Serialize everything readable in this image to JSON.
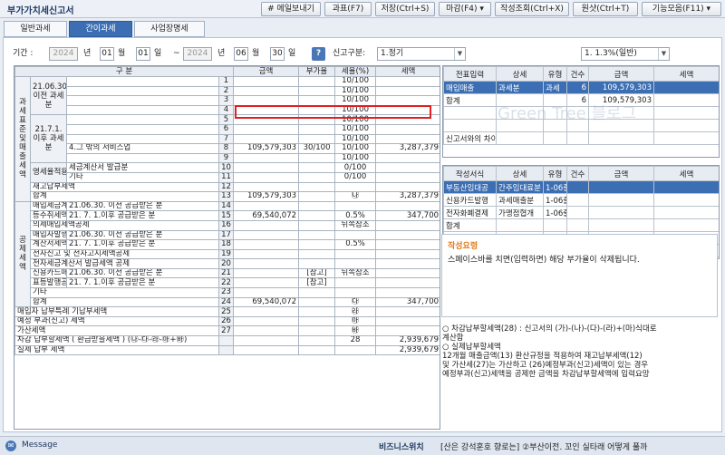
{
  "window": {
    "title": "부가가치세신고서"
  },
  "toolbar": {
    "buttons": [
      "# 메일보내기",
      "과표(F7)",
      "저장(Ctrl+S)",
      "마감(F4) ▾",
      "작성조회(Ctrl+X)",
      "원샷(Ctrl+T)",
      "기능모음(F11) ▾"
    ]
  },
  "tabs": [
    "일반과세",
    "간이과세",
    "사업장명세"
  ],
  "criteria": {
    "period_label": "기간 :",
    "start_year": "2024",
    "start_month": "01",
    "start_day": "01",
    "end_year": "2024",
    "end_month": "06",
    "end_day": "30",
    "year_unit": "년",
    "month_unit": "월",
    "day_unit": "일",
    "tilde": "~",
    "help": "?",
    "report_type_label": "신고구분:",
    "report_type": "1.정기",
    "rate_option": "1. 1.3%(일반)"
  },
  "main_table": {
    "header": [
      "구 분",
      "금액",
      "부가율",
      "세율(%)",
      "세액"
    ],
    "side_labels": {
      "tax_base": "과세표준및매출세액",
      "deduction": "공제세액"
    },
    "rows": [
      {
        "g": "21.06.30.이전 과세분",
        "sub": "",
        "no": "1",
        "amt": "",
        "rate": "",
        "pct": "10/100",
        "tax": ""
      },
      {
        "g": "",
        "sub": "",
        "no": "2",
        "amt": "",
        "rate": "",
        "pct": "10/100",
        "tax": ""
      },
      {
        "g": "",
        "sub": "",
        "no": "3",
        "amt": "",
        "rate": "",
        "pct": "10/100",
        "tax": ""
      },
      {
        "g": "",
        "sub": "",
        "no": "4",
        "amt": "",
        "rate": "",
        "pct": "10/100",
        "tax": ""
      },
      {
        "g": "21.7.1.이후 과세분",
        "sub": "",
        "no": "5",
        "amt": "",
        "rate": "",
        "pct": "10/100",
        "tax": ""
      },
      {
        "g": "",
        "sub": "",
        "no": "6",
        "amt": "",
        "rate": "",
        "pct": "10/100",
        "tax": ""
      },
      {
        "g": "",
        "sub": "",
        "no": "7",
        "amt": "",
        "rate": "",
        "pct": "10/100",
        "tax": ""
      },
      {
        "g": "",
        "sub": "4.그 밖의 서비스업",
        "no": "8",
        "amt": "109,579,303",
        "rate": "30/100",
        "pct": "10/100",
        "tax": "3,287,379"
      },
      {
        "g": "",
        "sub": "",
        "no": "9",
        "amt": "",
        "rate": "",
        "pct": "10/100",
        "tax": ""
      },
      {
        "g": "영세율적용분",
        "sub": "세금계산서 발급분",
        "no": "10",
        "amt": "",
        "rate": "",
        "pct": "0/100",
        "tax": ""
      },
      {
        "g": "",
        "sub": "기타",
        "no": "11",
        "amt": "",
        "rate": "",
        "pct": "0/100",
        "tax": ""
      },
      {
        "g": "재고납부세액",
        "sub": "",
        "no": "12",
        "amt": "",
        "rate": "",
        "pct": "",
        "tax": ""
      },
      {
        "g": "합계",
        "sub": "",
        "no": "13",
        "amt": "109,579,303",
        "rate": "",
        "pct": "㉯",
        "tax": "3,287,379"
      },
      {
        "g": "매입세금계산서",
        "sub": "21.06.30. 이전 공급받은 분",
        "no": "14",
        "amt": "",
        "rate": "",
        "pct": "",
        "tax": ""
      },
      {
        "g": "등수취세액공제",
        "sub": "21. 7. 1.이후 공급받은 분",
        "no": "15",
        "amt": "69,540,072",
        "rate": "",
        "pct": "0.5%",
        "tax": "347,700"
      },
      {
        "g": "의제매입세액공제",
        "sub": "",
        "no": "16",
        "amt": "",
        "rate": "",
        "pct": "뒤쪽참조",
        "tax": ""
      },
      {
        "g": "매입자발행세금",
        "sub": "21.06.30. 이전 공급받은 분",
        "no": "17",
        "amt": "",
        "rate": "",
        "pct": "",
        "tax": ""
      },
      {
        "g": "계산서세액공제",
        "sub": "21. 7. 1.이후 공급받은 분",
        "no": "18",
        "amt": "",
        "rate": "",
        "pct": "0.5%",
        "tax": ""
      },
      {
        "g": "전자신고 및 전자고지세액공제",
        "sub": "",
        "no": "19",
        "amt": "",
        "rate": "",
        "pct": "",
        "tax": ""
      },
      {
        "g": "전자세금계산서 발급세액 공제",
        "sub": "",
        "no": "20",
        "amt": "",
        "rate": "",
        "pct": "",
        "tax": ""
      },
      {
        "g": "신용카드매출전",
        "sub": "21.06.30. 이전 공급받은 분",
        "no": "21",
        "amt": "",
        "rate": "[참고]",
        "pct": "뒤쪽참조",
        "tax": ""
      },
      {
        "g": "표등발행공제계",
        "sub": "21. 7. 1.이후 공급받은 분",
        "no": "22",
        "amt": "",
        "rate": "[참고]",
        "pct": "",
        "tax": ""
      },
      {
        "g": "기타",
        "sub": "",
        "no": "23",
        "amt": "",
        "rate": "",
        "pct": "",
        "tax": ""
      },
      {
        "g": "합계",
        "sub": "",
        "no": "24",
        "amt": "69,540,072",
        "rate": "",
        "pct": "㉰",
        "tax": "347,700"
      },
      {
        "g": "매입자 납부특례 기납부세액",
        "sub": "",
        "no": "25",
        "amt": "",
        "rate": "",
        "pct": "㉱",
        "tax": ""
      },
      {
        "g": "예정 부과(신고) 세액",
        "sub": "",
        "no": "26",
        "amt": "",
        "rate": "",
        "pct": "㉲",
        "tax": ""
      },
      {
        "g": "가산세액",
        "sub": "",
        "no": "27",
        "amt": "",
        "rate": "",
        "pct": "㉳",
        "tax": ""
      },
      {
        "g": "차감 납부할세액 ( 환급받을세액 ) (㉯-㉰-㉱-㉲+㉳)",
        "sub": "",
        "no": "",
        "amt": "",
        "rate": "",
        "pct": "28",
        "tax": "2,939,679"
      },
      {
        "g": "실제 납부 세액",
        "sub": "",
        "no": "",
        "amt": "",
        "rate": "",
        "pct": "",
        "tax": "2,939,679"
      }
    ]
  },
  "right_table1": {
    "header": [
      "전표입력",
      "상세",
      "유형",
      "건수",
      "금액",
      "세액"
    ],
    "rows": [
      {
        "c": [
          "매입매출",
          "과세분",
          "과세",
          "6",
          "109,579,303",
          ""
        ],
        "sel": true
      },
      {
        "c": [
          "합계",
          "",
          "",
          "6",
          "109,579,303",
          ""
        ],
        "sel": false
      },
      {
        "c": [
          "",
          "",
          "",
          "",
          "",
          ""
        ],
        "sel": false
      },
      {
        "c": [
          "",
          "",
          "",
          "",
          "",
          ""
        ],
        "sel": false
      },
      {
        "c": [
          "신고서와의 차이",
          "",
          "",
          "",
          "",
          ""
        ],
        "sel": false
      }
    ],
    "watermark": "Green Tree 블로그"
  },
  "right_table2": {
    "header": [
      "작성서식",
      "상세",
      "유형",
      "건수",
      "금액",
      "세액"
    ],
    "rows": [
      {
        "c": [
          "부동산임대공",
          "간주임대료분",
          "1-06줄",
          "",
          "",
          ""
        ],
        "sel": true
      },
      {
        "c": [
          "신용카드발행",
          "과세매출분",
          "1-06줄",
          "",
          "",
          ""
        ],
        "sel": false
      },
      {
        "c": [
          "전자화폐결제",
          "가맹점협개",
          "1-06줄",
          "",
          "",
          ""
        ],
        "sel": false
      },
      {
        "c": [
          "합계",
          "",
          "",
          "",
          "",
          ""
        ],
        "sel": false
      },
      {
        "c": [
          "",
          "",
          "",
          "",
          "",
          ""
        ],
        "sel": false
      },
      {
        "c": [
          "신고서와의 차이",
          "",
          "",
          "",
          "",
          ""
        ],
        "sel": false
      }
    ]
  },
  "note": {
    "title": "작성요령",
    "body": "스페이스바를 치면(입력하면) 해당 부가율이 삭제됩니다."
  },
  "notes2": [
    "○ 차감납부할세액(28) : 신고서의 (가)-(나)-(다)-(라)+(마)식대로",
    "   계산함",
    "○ 실제납부할세액",
    "   12개월 매출금액(13) 환산규정을 적용하여 재고납부세액(12)",
    "   및 가산세(27)는 가산하고 (26)예정부과(신고)세액이 있는 경우",
    "   예정부과(신고)세액을 공제한 금액을 차감납부할세액에 입력요망"
  ],
  "statusbar": {
    "message": "Message",
    "biz": "비즈니스위치",
    "ticker": "[산은 강석훈호 향로는] ②부산이전. 꼬인 실타래 어떻게 풀까"
  }
}
